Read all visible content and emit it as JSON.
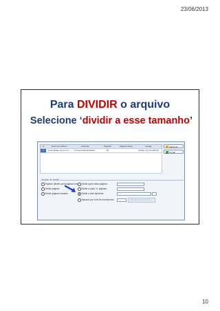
{
  "header": {
    "date": "23/06/2013"
  },
  "footer": {
    "page_number": "10"
  },
  "slide": {
    "title_before": "Para ",
    "title_highlight": "DIVIDIR",
    "title_after": " o arquivo",
    "subtitle_before": "Selecione ‘",
    "subtitle_highlight": "dividir a esse tamanho",
    "subtitle_after": "’"
  },
  "screenshot": {
    "table_headers": [
      "#",
      "Nome do ficheiro",
      "Caminho",
      "Páginas",
      "Palavra-passe",
      "Versão"
    ],
    "table_row": [
      "1",
      "Amendolate do livro el...",
      "C:\\Users\\Alexandra\\Do...",
      "26",
      "",
      "Versão 1.4 (Acrobat 5)"
    ],
    "buttons": {
      "add": "Adicionar",
      "clear": "Limpar"
    },
    "options_title": "Opções de divisão",
    "options": {
      "burst": "Rupture (dividir para páginas únicas)",
      "split_pages": "Dividir páginas",
      "split_odd": "Dividir páginas ímpares",
      "split_after": "Dividir após estas páginas:",
      "split_every": "Dividir a cada \"n\" páginas:",
      "split_size": "Dividir a este tamanho:",
      "split_bookmarks": "Separar por nível de marcadores:"
    },
    "disabled_button": "Marcador de documento..."
  },
  "colors": {
    "title": "#1f3b78",
    "highlight": "#c00000",
    "arrow": "#1e3fbf"
  }
}
